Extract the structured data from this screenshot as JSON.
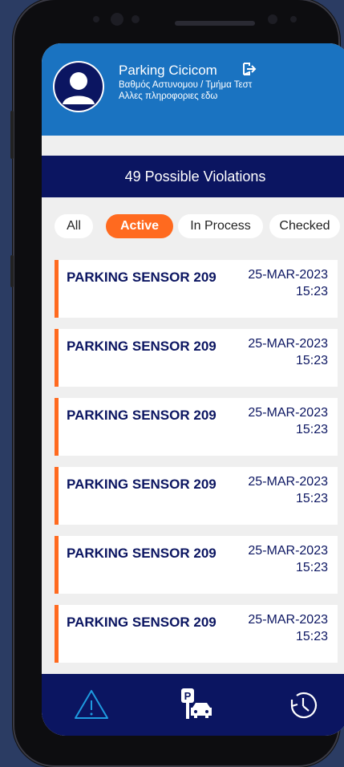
{
  "user": {
    "name": "Parking Cicicom",
    "role": "Βαθμός Αστυνομου / Τμήμα Τεστ",
    "info": "Αλλες πληροφοριες εδω",
    "logout_icon": "logout-icon"
  },
  "banner": {
    "text": "49 Possible Violations"
  },
  "filters": [
    {
      "label": "All",
      "active": false
    },
    {
      "label": "Active",
      "active": true
    },
    {
      "label": "In Process",
      "active": false
    },
    {
      "label": "Checked",
      "active": false
    }
  ],
  "violations": [
    {
      "title": "PARKING SENSOR 209",
      "date": "25-MAR-2023",
      "time": "15:23"
    },
    {
      "title": "PARKING SENSOR 209",
      "date": "25-MAR-2023",
      "time": "15:23"
    },
    {
      "title": "PARKING SENSOR 209",
      "date": "25-MAR-2023",
      "time": "15:23"
    },
    {
      "title": "PARKING SENSOR 209",
      "date": "25-MAR-2023",
      "time": "15:23"
    },
    {
      "title": "PARKING SENSOR 209",
      "date": "25-MAR-2023",
      "time": "15:23"
    },
    {
      "title": "PARKING SENSOR 209",
      "date": "25-MAR-2023",
      "time": "15:23"
    }
  ],
  "nav": [
    {
      "icon": "warning-icon",
      "active": true
    },
    {
      "icon": "parking-car-icon",
      "active": false
    },
    {
      "icon": "history-icon",
      "active": false
    }
  ],
  "colors": {
    "header": "#1a73c1",
    "navy": "#0b1561",
    "accent": "#ff6a1f",
    "active_nav": "#1e9be0"
  }
}
